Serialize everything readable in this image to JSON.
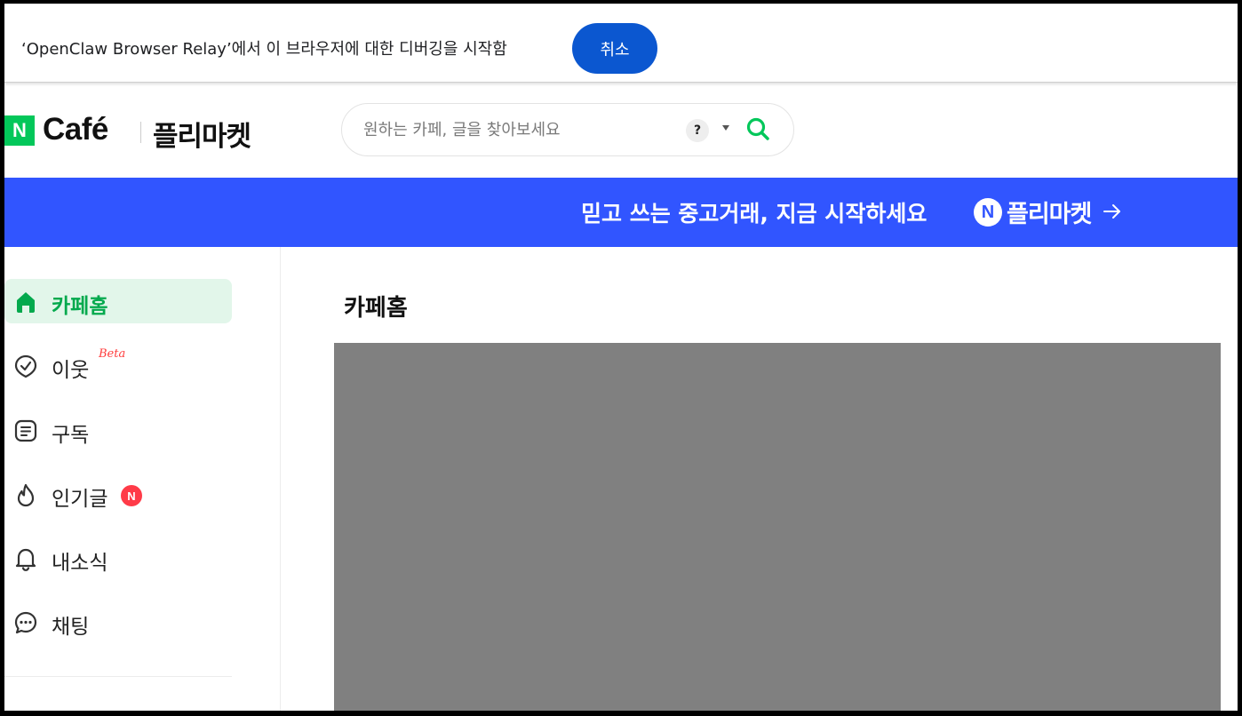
{
  "debug_bar": {
    "message": "‘OpenClaw Browser Relay’에서 이 브라우저에 대한 디버깅을 시작함",
    "cancel_label": "취소"
  },
  "header": {
    "logo_n": "N",
    "logo_cafe": "Café",
    "logo_market": "플리마켓",
    "search_placeholder": "원하는 카페, 글을 찾아보세요",
    "help_symbol": "?"
  },
  "banner": {
    "text": "믿고 쓰는 중고거래, 지금 시작하세요",
    "badge": "N",
    "brand": "플리마켓"
  },
  "sidebar": {
    "items": [
      {
        "label": "카페홈",
        "icon": "home-icon",
        "active": true
      },
      {
        "label": "이웃",
        "icon": "check-badge-icon",
        "tag": "Beta"
      },
      {
        "label": "구독",
        "icon": "document-icon"
      },
      {
        "label": "인기글",
        "icon": "flame-icon",
        "badge": "N"
      },
      {
        "label": "내소식",
        "icon": "bell-icon"
      },
      {
        "label": "채팅",
        "icon": "chat-icon"
      }
    ]
  },
  "main": {
    "title": "카페홈"
  },
  "colors": {
    "accent_green": "#03c75a",
    "banner_blue": "#3155ff",
    "debug_button": "#0b57d0",
    "active_bg": "#e2f6ea",
    "new_badge": "#ff3b48"
  }
}
